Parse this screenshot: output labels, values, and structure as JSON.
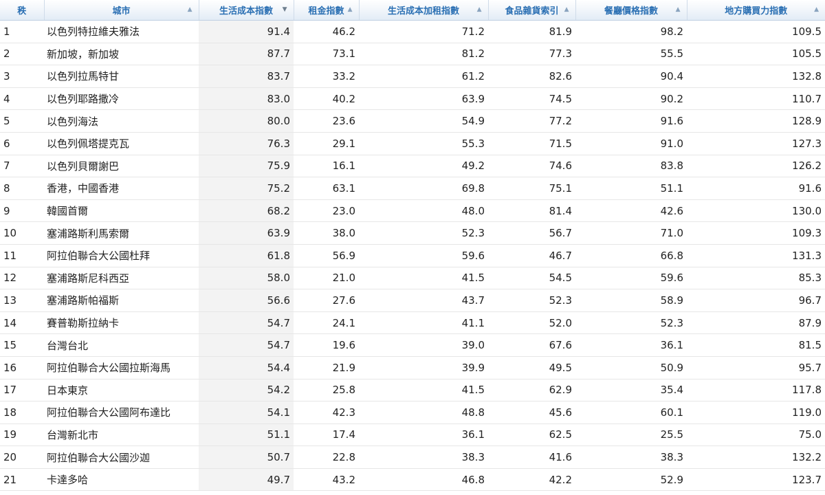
{
  "table": {
    "headers": [
      {
        "label": "秩",
        "sort": ""
      },
      {
        "label": "城市",
        "sort": "▲"
      },
      {
        "label": "生活成本指數",
        "sort": "▼"
      },
      {
        "label": "租金指數",
        "sort": "▲"
      },
      {
        "label": "生活成本加租指數",
        "sort": "▲"
      },
      {
        "label": "食品雜貨索引",
        "sort": "▲"
      },
      {
        "label": "餐廳價格指數",
        "sort": "▲"
      },
      {
        "label": "地方購買力指數",
        "sort": "▲"
      }
    ],
    "rows": [
      {
        "rank": "1",
        "city": "以色列特拉維夫雅法",
        "col": "91.4",
        "rent": "46.2",
        "crp": "71.2",
        "groc": "81.9",
        "rest": "98.2",
        "lpp": "109.5"
      },
      {
        "rank": "2",
        "city": "新加坡，新加坡",
        "col": "87.7",
        "rent": "73.1",
        "crp": "81.2",
        "groc": "77.3",
        "rest": "55.5",
        "lpp": "105.5"
      },
      {
        "rank": "3",
        "city": "以色列拉馬特甘",
        "col": "83.7",
        "rent": "33.2",
        "crp": "61.2",
        "groc": "82.6",
        "rest": "90.4",
        "lpp": "132.8"
      },
      {
        "rank": "4",
        "city": "以色列耶路撒冷",
        "col": "83.0",
        "rent": "40.2",
        "crp": "63.9",
        "groc": "74.5",
        "rest": "90.2",
        "lpp": "110.7"
      },
      {
        "rank": "5",
        "city": "以色列海法",
        "col": "80.0",
        "rent": "23.6",
        "crp": "54.9",
        "groc": "77.2",
        "rest": "91.6",
        "lpp": "128.9"
      },
      {
        "rank": "6",
        "city": "以色列佩塔提克瓦",
        "col": "76.3",
        "rent": "29.1",
        "crp": "55.3",
        "groc": "71.5",
        "rest": "91.0",
        "lpp": "127.3"
      },
      {
        "rank": "7",
        "city": "以色列貝爾謝巴",
        "col": "75.9",
        "rent": "16.1",
        "crp": "49.2",
        "groc": "74.6",
        "rest": "83.8",
        "lpp": "126.2"
      },
      {
        "rank": "8",
        "city": "香港，中國香港",
        "col": "75.2",
        "rent": "63.1",
        "crp": "69.8",
        "groc": "75.1",
        "rest": "51.1",
        "lpp": "91.6"
      },
      {
        "rank": "9",
        "city": "韓國首爾",
        "col": "68.2",
        "rent": "23.0",
        "crp": "48.0",
        "groc": "81.4",
        "rest": "42.6",
        "lpp": "130.0"
      },
      {
        "rank": "10",
        "city": "塞浦路斯利馬索爾",
        "col": "63.9",
        "rent": "38.0",
        "crp": "52.3",
        "groc": "56.7",
        "rest": "71.0",
        "lpp": "109.3"
      },
      {
        "rank": "11",
        "city": "阿拉伯聯合大公國杜拜",
        "col": "61.8",
        "rent": "56.9",
        "crp": "59.6",
        "groc": "46.7",
        "rest": "66.8",
        "lpp": "131.3"
      },
      {
        "rank": "12",
        "city": "塞浦路斯尼科西亞",
        "col": "58.0",
        "rent": "21.0",
        "crp": "41.5",
        "groc": "54.5",
        "rest": "59.6",
        "lpp": "85.3"
      },
      {
        "rank": "13",
        "city": "塞浦路斯帕福斯",
        "col": "56.6",
        "rent": "27.6",
        "crp": "43.7",
        "groc": "52.3",
        "rest": "58.9",
        "lpp": "96.7"
      },
      {
        "rank": "14",
        "city": "賽普勒斯拉納卡",
        "col": "54.7",
        "rent": "24.1",
        "crp": "41.1",
        "groc": "52.0",
        "rest": "52.3",
        "lpp": "87.9"
      },
      {
        "rank": "15",
        "city": "台灣台北",
        "col": "54.7",
        "rent": "19.6",
        "crp": "39.0",
        "groc": "67.6",
        "rest": "36.1",
        "lpp": "81.5"
      },
      {
        "rank": "16",
        "city": "阿拉伯聯合大公國拉斯海馬",
        "col": "54.4",
        "rent": "21.9",
        "crp": "39.9",
        "groc": "49.5",
        "rest": "50.9",
        "lpp": "95.7"
      },
      {
        "rank": "17",
        "city": "日本東京",
        "col": "54.2",
        "rent": "25.8",
        "crp": "41.5",
        "groc": "62.9",
        "rest": "35.4",
        "lpp": "117.8"
      },
      {
        "rank": "18",
        "city": "阿拉伯聯合大公國阿布達比",
        "col": "54.1",
        "rent": "42.3",
        "crp": "48.8",
        "groc": "45.6",
        "rest": "60.1",
        "lpp": "119.0"
      },
      {
        "rank": "19",
        "city": "台灣新北市",
        "col": "51.1",
        "rent": "17.4",
        "crp": "36.1",
        "groc": "62.5",
        "rest": "25.5",
        "lpp": "75.0"
      },
      {
        "rank": "20",
        "city": "阿拉伯聯合大公國沙迦",
        "col": "50.7",
        "rent": "22.8",
        "crp": "38.3",
        "groc": "41.6",
        "rest": "38.3",
        "lpp": "132.2"
      },
      {
        "rank": "21",
        "city": "卡達多哈",
        "col": "49.7",
        "rent": "43.2",
        "crp": "46.8",
        "groc": "42.2",
        "rest": "52.9",
        "lpp": "123.7"
      }
    ]
  }
}
